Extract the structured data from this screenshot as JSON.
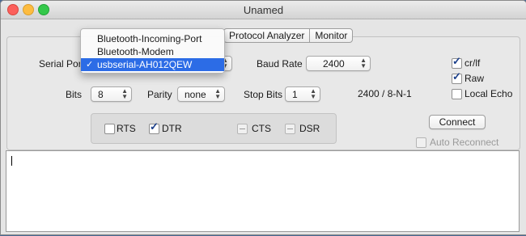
{
  "window": {
    "title": "Unamed"
  },
  "tabs": [
    {
      "label": "Protocol Analyzer"
    },
    {
      "label": "Monitor"
    }
  ],
  "settings": {
    "serial_port": {
      "label": "Serial Port"
    },
    "baud_rate": {
      "label": "Baud Rate",
      "value": "2400"
    },
    "bits": {
      "label": "Bits",
      "value": "8"
    },
    "parity": {
      "label": "Parity",
      "value": "none"
    },
    "stop_bits": {
      "label": "Stop Bits",
      "value": "1"
    },
    "summary": "2400 / 8-N-1"
  },
  "options": {
    "cr_lf": {
      "label": "cr/lf",
      "checked": true
    },
    "raw": {
      "label": "Raw",
      "checked": true
    },
    "local_echo": {
      "label": "Local Echo",
      "checked": false
    }
  },
  "pins": {
    "rts": {
      "label": "RTS",
      "checked": false
    },
    "dtr": {
      "label": "DTR",
      "checked": true
    },
    "cts": {
      "label": "CTS",
      "disabled": true
    },
    "dsr": {
      "label": "DSR",
      "disabled": true
    }
  },
  "actions": {
    "connect": "Connect",
    "auto_reconnect": {
      "label": "Auto Reconnect",
      "checked": false,
      "disabled": true
    }
  },
  "port_menu": {
    "items": [
      {
        "label": "Bluetooth-Incoming-Port",
        "selected": false
      },
      {
        "label": "Bluetooth-Modem",
        "selected": false
      },
      {
        "label": "usbserial-AH012QEW",
        "selected": true
      }
    ],
    "check_glyph": "✓"
  },
  "terminal": {
    "content": ""
  },
  "colors": {
    "selection": "#2c6ce6",
    "checkmark": "#1b3f8a"
  }
}
